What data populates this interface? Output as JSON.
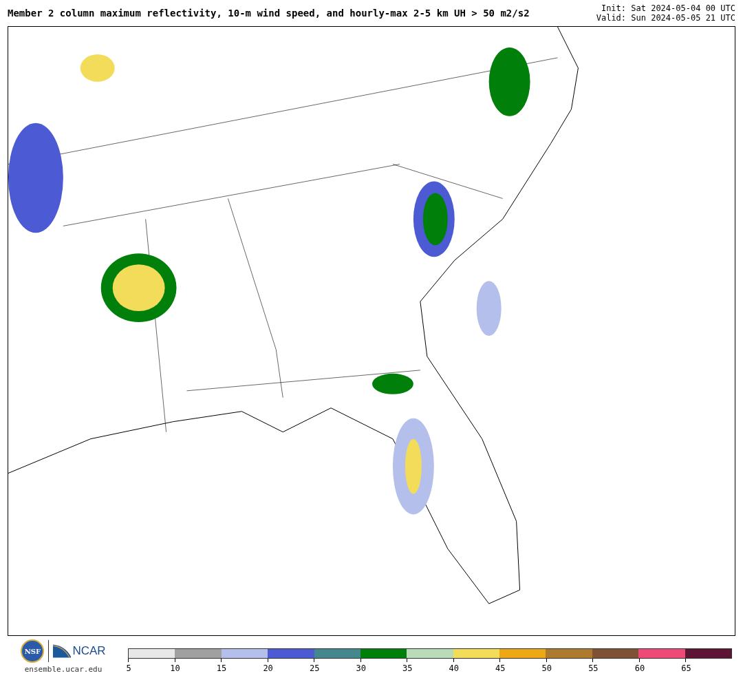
{
  "header": {
    "title": "Member 2 column maximum reflectivity, 10-m wind speed, and hourly-max 2-5 km UH > 50 m2/s2",
    "init": "Init: Sat 2024-05-04 00 UTC",
    "valid": "Valid: Sun 2024-05-05 21 UTC"
  },
  "footer": {
    "nsf_logo": "NSF",
    "ncar_logo": "NCAR",
    "website": "ensemble.ucar.edu"
  },
  "colorbar": {
    "bins": [
      {
        "label": "5",
        "color": "#e8e8e8"
      },
      {
        "label": "10",
        "color": "#a0a0a0"
      },
      {
        "label": "15",
        "color": "#b4bfec"
      },
      {
        "label": "20",
        "color": "#4c5bd4"
      },
      {
        "label": "25",
        "color": "#43888c"
      },
      {
        "label": "30",
        "color": "#00800a"
      },
      {
        "label": "35",
        "color": "#b8dcb8"
      },
      {
        "label": "40",
        "color": "#f2dc5a"
      },
      {
        "label": "45",
        "color": "#eda815"
      },
      {
        "label": "50",
        "color": "#ae7a2e"
      },
      {
        "label": "55",
        "color": "#7f5235"
      },
      {
        "label": "60",
        "color": "#ee4a78"
      },
      {
        "label": "65",
        "color": "#5e1435"
      }
    ]
  }
}
